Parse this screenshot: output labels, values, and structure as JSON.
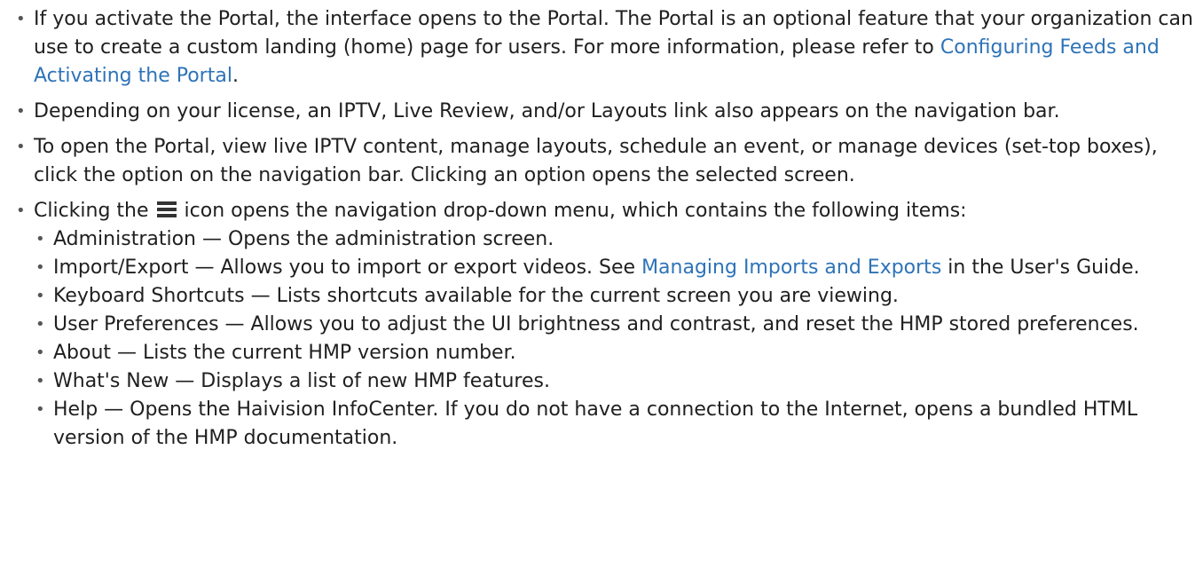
{
  "bullets": {
    "portal": {
      "before": "If you activate the Portal, the interface opens to the Portal. The Portal is an optional feature that your organization can use to create a custom landing (home) page for users. For more information, please refer to ",
      "link": "Configuring Feeds and Activating the Portal",
      "after": "."
    },
    "license": {
      "text": "Depending on your license, an IPTV, Live Review, and/or Layouts link also appears on the navigation bar."
    },
    "open": {
      "text": "To open the Portal, view live IPTV content, manage layouts, schedule an event, or manage devices (set-top boxes), click the option on the navigation bar.  Clicking an option opens the selected screen."
    },
    "menu": {
      "before": "Clicking the ",
      "icon": "hamburger-menu-icon",
      "after": " icon opens the navigation drop-down menu, which contains the following items:",
      "items": [
        {
          "term": "Administration",
          "desc": " — Opens the administration screen."
        },
        {
          "term": "Import/Export",
          "desc": " — Allows you to import or export videos. See ",
          "link": "Managing Imports and Exports",
          "after": " in the User's Guide."
        },
        {
          "term": "Keyboard Shortcuts",
          "desc": " — Lists shortcuts available for the current screen you are viewing."
        },
        {
          "term": "User Preferences",
          "desc": " — Allows you to adjust the UI brightness and contrast, and reset the HMP stored preferences."
        },
        {
          "term": "About",
          "desc": " — Lists the current HMP version number."
        },
        {
          "term": "What's New",
          "desc": " — Displays a list of new HMP features."
        },
        {
          "term": "Help",
          "desc": " — Opens the Haivision InfoCenter. If you do not have a connection to the Internet, opens a bundled HTML version of the HMP documentation."
        }
      ]
    }
  },
  "colors": {
    "link": "#2e73b8",
    "text": "#1f1f1f"
  }
}
